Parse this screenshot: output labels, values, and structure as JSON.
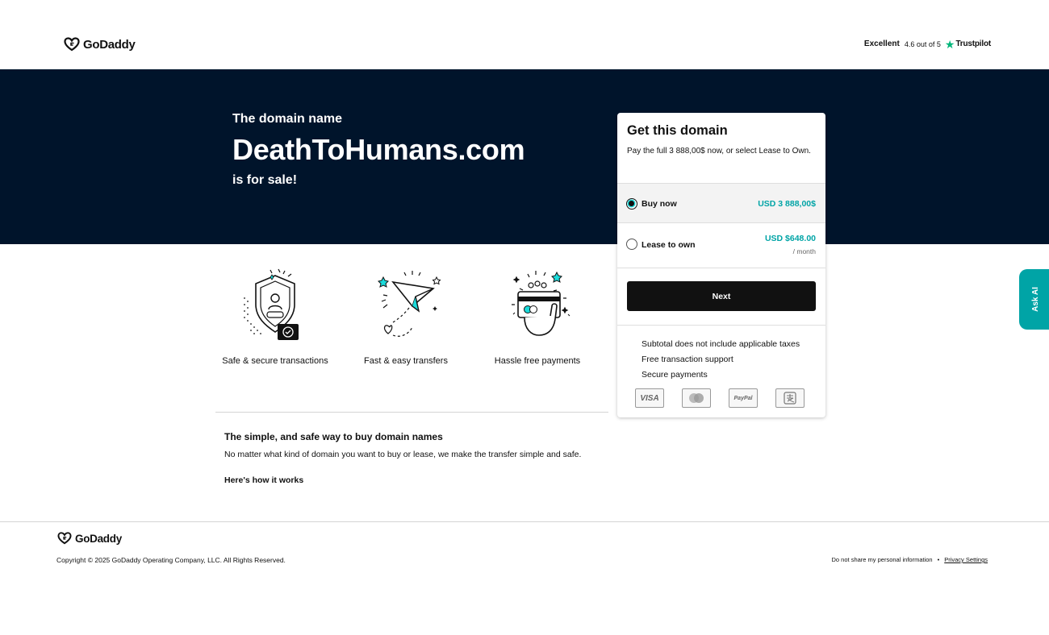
{
  "header": {
    "brand": "GoDaddy",
    "trustpilot": {
      "rating_word": "Excellent",
      "score": "4.6 out of 5",
      "brand": "Trustpilot"
    }
  },
  "hero": {
    "pre": "The domain name",
    "domain": "DeathToHumans.com",
    "post": "is for sale!"
  },
  "features": [
    {
      "icon": "shield-lock-icon",
      "label": "Safe & secure transactions"
    },
    {
      "icon": "paper-plane-icon",
      "label": "Fast & easy transfers"
    },
    {
      "icon": "card-hand-icon",
      "label": "Hassle free payments"
    }
  ],
  "info": {
    "title": "The simple, and safe way to buy domain names",
    "desc": "No matter what kind of domain you want to buy or lease, we make the transfer simple and safe.",
    "link": "Here's how it works"
  },
  "card": {
    "title": "Get this domain",
    "subtitle": "Pay the full 3 888,00$ now, or select Lease to Own.",
    "buy": {
      "label": "Buy now",
      "price": "USD 3 888,00$",
      "selected": true
    },
    "lease": {
      "label": "Lease to own",
      "price": "USD $648.00",
      "per": "/ month",
      "selected": false
    },
    "next_label": "Next",
    "bullets": [
      "Subtotal does not include applicable taxes",
      "Free transaction support",
      "Secure payments"
    ],
    "payments": {
      "visa": "VISA",
      "paypal": "PayPal"
    }
  },
  "ask_ai": "Ask AI",
  "footer": {
    "brand": "GoDaddy",
    "copyright": "Copyright © 2025 GoDaddy Operating Company, LLC. All Rights Reserved.",
    "do_not_share": "Do not share my personal information",
    "separator": "•",
    "privacy": "Privacy Settings"
  },
  "colors": {
    "hero_bg": "#00142b",
    "accent": "#00a4a6",
    "button": "#111111"
  }
}
